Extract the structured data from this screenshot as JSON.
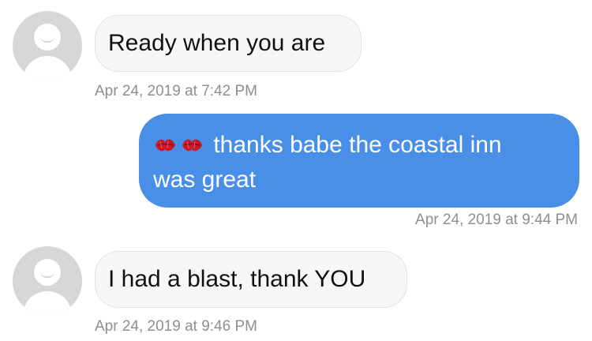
{
  "messages": [
    {
      "direction": "incoming",
      "text": "Ready when you are",
      "timestamp": "Apr 24, 2019 at 7:42 PM"
    },
    {
      "direction": "outgoing",
      "emoji": "kiss-mark-emoji x2",
      "text_line1": "thanks babe the coastal inn",
      "text_line2": "was great",
      "timestamp": "Apr 24, 2019 at 9:44 PM"
    },
    {
      "direction": "incoming",
      "text": "I had a blast, thank YOU",
      "timestamp": "Apr 24, 2019 at 9:46 PM"
    }
  ],
  "colors": {
    "outgoing_bubble": "#4a8fe7",
    "incoming_bubble": "#f7f7f7",
    "timestamp": "#8e8e93",
    "avatar": "#d7d7d9",
    "kiss_emoji": "#c8192b"
  }
}
